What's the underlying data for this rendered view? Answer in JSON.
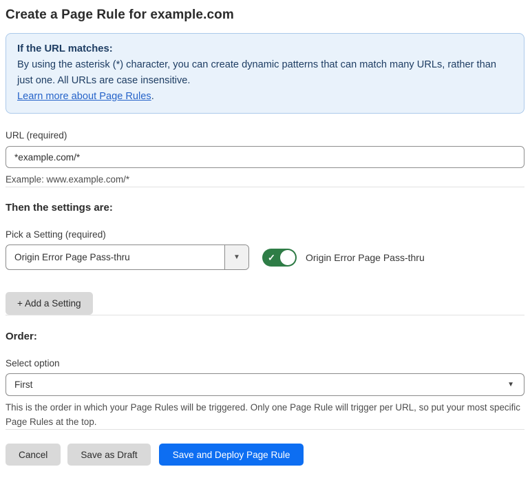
{
  "page": {
    "title": "Create a Page Rule for example.com"
  },
  "info_box": {
    "heading": "If the URL matches:",
    "body": "By using the asterisk (*) character, you can create dynamic patterns that can match many URLs, rather than just one. All URLs are case insensitive.",
    "link_label": "Learn more about Page Rules",
    "link_suffix": "."
  },
  "url_field": {
    "label": "URL (required)",
    "value": "*example.com/*",
    "help": "Example: www.example.com/*"
  },
  "settings_section": {
    "heading": "Then the settings are:",
    "picker_label": "Pick a Setting (required)",
    "selected_setting": "Origin Error Page Pass-thru",
    "toggle_state": "on",
    "toggle_label": "Origin Error Page Pass-thru",
    "add_setting_label": "+ Add a Setting"
  },
  "order_section": {
    "heading": "Order:",
    "select_label": "Select option",
    "selected_option": "First",
    "help": "This is the order in which your Page Rules will be triggered. Only one Page Rule will trigger per URL, so put your most specific Page Rules at the top."
  },
  "footer": {
    "cancel_label": "Cancel",
    "save_draft_label": "Save as Draft",
    "save_deploy_label": "Save and Deploy Page Rule"
  },
  "icons": {
    "caret_down": "▼",
    "check": "✓"
  },
  "colors": {
    "info_background": "#e9f2fb",
    "info_border": "#abc9ea",
    "info_text": "#1e3d63",
    "link_blue": "#2563c9",
    "toggle_green": "#2e7d46",
    "primary_button_blue": "#0d6ef2",
    "secondary_button_gray": "#d9d9d9"
  }
}
